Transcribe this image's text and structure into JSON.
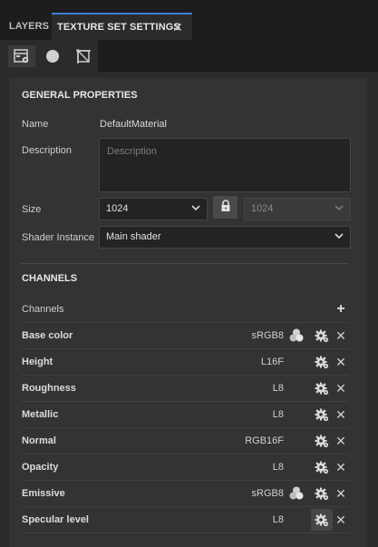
{
  "tabs": [
    {
      "label": "LAYERS"
    },
    {
      "label": "TEXTURE SET SETTINGS",
      "active": true
    }
  ],
  "toolbar_icons": [
    "texture-set-settings-icon",
    "material-sphere-icon",
    "uv-crop-icon"
  ],
  "general": {
    "title": "GENERAL PROPERTIES",
    "name_label": "Name",
    "name_value": "DefaultMaterial",
    "description_label": "Description",
    "description_placeholder": "Description",
    "size_label": "Size",
    "size_value": "1024",
    "size_linked_value": "1024",
    "shader_label": "Shader Instance",
    "shader_value": "Main shader"
  },
  "channels": {
    "title": "CHANNELS",
    "header_label": "Channels",
    "items": [
      {
        "name": "Base color",
        "format": "sRGB8",
        "srgb_icon": true
      },
      {
        "name": "Height",
        "format": "L16F",
        "srgb_icon": false
      },
      {
        "name": "Roughness",
        "format": "L8",
        "srgb_icon": false
      },
      {
        "name": "Metallic",
        "format": "L8",
        "srgb_icon": false
      },
      {
        "name": "Normal",
        "format": "RGB16F",
        "srgb_icon": false
      },
      {
        "name": "Opacity",
        "format": "L8",
        "srgb_icon": false
      },
      {
        "name": "Emissive",
        "format": "sRGB8",
        "srgb_icon": true
      },
      {
        "name": "Specular level",
        "format": "L8",
        "srgb_icon": false
      }
    ]
  },
  "colors": {
    "accent": "#3b7fd6",
    "panel": "#333333",
    "background": "#2b2b2b"
  }
}
